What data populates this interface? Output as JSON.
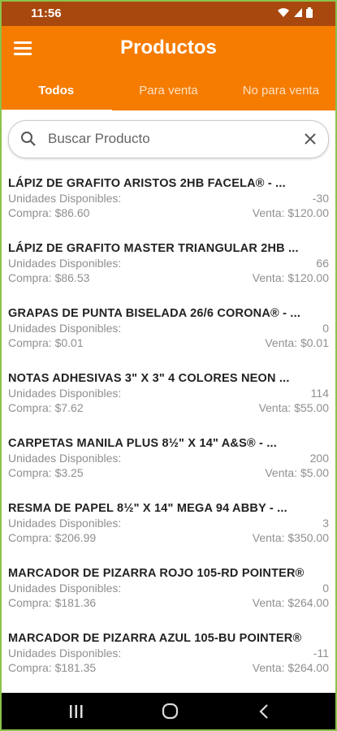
{
  "status_bar": {
    "time": "11:56"
  },
  "app_bar": {
    "title": "Productos"
  },
  "tabs": [
    {
      "label": "Todos"
    },
    {
      "label": "Para venta"
    },
    {
      "label": "No para venta"
    }
  ],
  "search": {
    "placeholder": "Buscar Producto"
  },
  "units_label": "Unidades Disponibles:",
  "products": [
    {
      "name": "LÁPIZ DE GRAFITO ARISTOS 2HB FACELA® - ...",
      "units": "-30",
      "buy": "Compra: $86.60",
      "sell": "Venta: $120.00"
    },
    {
      "name": "LÁPIZ DE GRAFITO MASTER TRIANGULAR 2HB ...",
      "units": "66",
      "buy": "Compra: $86.53",
      "sell": "Venta: $120.00"
    },
    {
      "name": "GRAPAS DE PUNTA BISELADA 26/6 CORONA® - ...",
      "units": "0",
      "buy": "Compra: $0.01",
      "sell": "Venta: $0.01"
    },
    {
      "name": "NOTAS ADHESIVAS 3\" X 3\" 4 COLORES NEON ...",
      "units": "114",
      "buy": "Compra: $7.62",
      "sell": "Venta: $55.00"
    },
    {
      "name": "CARPETAS MANILA PLUS 8½\" X 14\" A&S® - ...",
      "units": "200",
      "buy": "Compra: $3.25",
      "sell": "Venta: $5.00"
    },
    {
      "name": "RESMA DE PAPEL 8½\" X 14\" MEGA 94 ABBY - ...",
      "units": "3",
      "buy": "Compra: $206.99",
      "sell": "Venta: $350.00"
    },
    {
      "name": "MARCADOR DE PIZARRA ROJO 105-RD POINTER®",
      "units": "0",
      "buy": "Compra: $181.36",
      "sell": "Venta: $264.00"
    },
    {
      "name": "MARCADOR DE PIZARRA AZUL 105-BU POINTER®",
      "units": "-11",
      "buy": "Compra: $181.35",
      "sell": "Venta: $264.00"
    }
  ],
  "colors": {
    "primary": "#f57c00",
    "status_bar": "#a8470e",
    "frame": "#8bc34a"
  },
  "icons": [
    "wifi-icon",
    "signal-icon",
    "battery-icon",
    "menu-icon",
    "search-icon",
    "close-icon",
    "recents-icon",
    "home-icon",
    "back-icon"
  ]
}
